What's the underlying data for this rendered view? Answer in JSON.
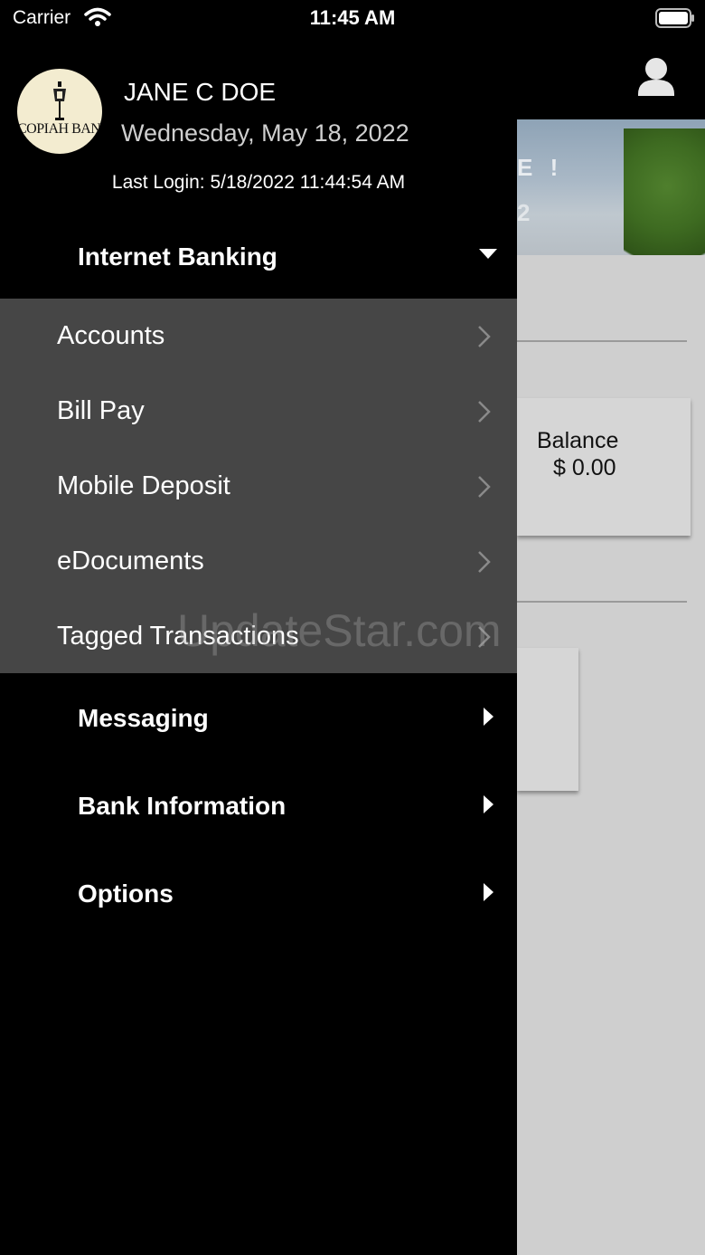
{
  "status_bar": {
    "carrier": "Carrier",
    "time": "11:45 AM"
  },
  "user": {
    "bank_logo_text": "COPIAH BANK",
    "name": "JANE C DOE",
    "date": "Wednesday, May 18, 2022",
    "last_login": "Last Login: 5/18/2022 11:44:54 AM"
  },
  "menu": {
    "internet_banking": "Internet Banking",
    "sub_items": [
      {
        "label": "Accounts"
      },
      {
        "label": "Bill Pay"
      },
      {
        "label": "Mobile Deposit"
      },
      {
        "label": "eDocuments"
      },
      {
        "label": "Tagged Transactions"
      }
    ],
    "messaging": "Messaging",
    "bank_information": "Bank Information",
    "options": "Options"
  },
  "background": {
    "hero_text_1": "E !",
    "hero_text_2": "2",
    "balance_label": "Balance",
    "balance_value": "$ 0.00"
  },
  "watermark": "UpdateStar.com"
}
